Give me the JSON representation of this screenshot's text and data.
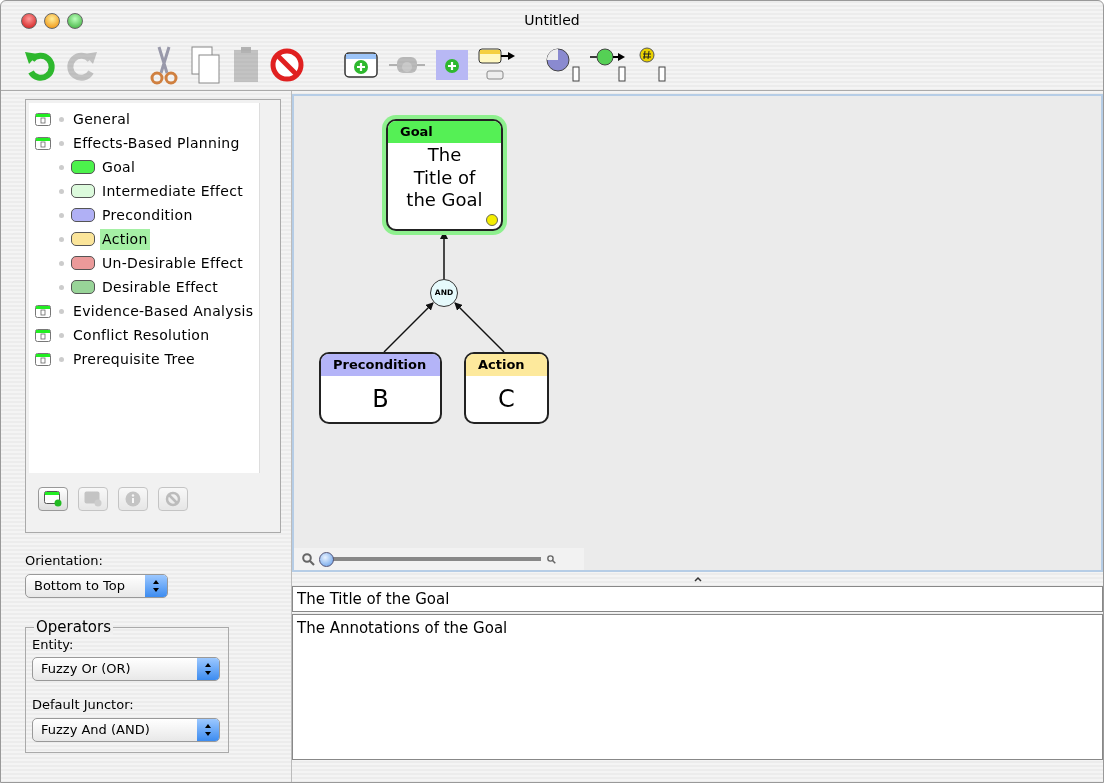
{
  "window": {
    "title": "Untitled"
  },
  "toolbar": [
    {
      "kind": "undo",
      "disabled": false
    },
    {
      "kind": "redo",
      "disabled": true
    },
    {
      "kind": "cut",
      "disabled": false
    },
    {
      "kind": "copy",
      "disabled": false
    },
    {
      "kind": "paste",
      "disabled": true
    },
    {
      "kind": "delete",
      "disabled": false
    },
    {
      "kind": "add-entity",
      "disabled": false
    },
    {
      "kind": "add-junctor",
      "disabled": true
    },
    {
      "kind": "add-child",
      "disabled": false
    },
    {
      "kind": "link",
      "disabled": false
    },
    {
      "kind": "pie",
      "disabled": false
    },
    {
      "kind": "green-link",
      "disabled": false
    },
    {
      "kind": "number",
      "disabled": false
    }
  ],
  "tree": [
    {
      "label": "General",
      "kind": "category",
      "selected": false
    },
    {
      "label": "Effects-Based Planning",
      "kind": "category",
      "selected": false,
      "children": [
        {
          "label": "Goal",
          "kind": "entity",
          "color": "#4cf24c",
          "selected": false
        },
        {
          "label": "Intermediate Effect",
          "kind": "entity",
          "color": "#dcfadc",
          "selected": false
        },
        {
          "label": "Precondition",
          "kind": "entity",
          "color": "#b0b0f5",
          "selected": false
        },
        {
          "label": "Action",
          "kind": "entity",
          "color": "#fbe59a",
          "selected": true
        },
        {
          "label": "Un-Desirable Effect",
          "kind": "entity",
          "color": "#eb9a9a",
          "selected": false
        },
        {
          "label": "Desirable Effect",
          "kind": "entity",
          "color": "#98d498",
          "selected": false
        }
      ]
    },
    {
      "label": "Evidence-Based Analysis",
      "kind": "category",
      "selected": false
    },
    {
      "label": "Conflict Resolution",
      "kind": "category",
      "selected": false
    },
    {
      "label": "Prerequisite Tree",
      "kind": "category",
      "selected": false
    }
  ],
  "tree_buttons": [
    {
      "kind": "add-category",
      "disabled": false
    },
    {
      "kind": "add-entity",
      "disabled": true
    },
    {
      "kind": "info",
      "disabled": true
    },
    {
      "kind": "delete",
      "disabled": true
    }
  ],
  "orientation": {
    "label": "Orientation:",
    "value": "Bottom to Top"
  },
  "operators": {
    "title": "Operators",
    "entity_label": "Entity:",
    "entity_value": "Fuzzy Or (OR)",
    "junctor_label": "Default Junctor:",
    "junctor_value": "Fuzzy And (AND)"
  },
  "diagram": {
    "nodes": [
      {
        "type": "Goal",
        "title": "The Title of the Goal",
        "color": "#55f055",
        "selected": true
      },
      {
        "type": "Precondition",
        "title": "B",
        "color": "#b4b4f8",
        "selected": false
      },
      {
        "type": "Action",
        "title": "C",
        "color": "#fde99c",
        "selected": false
      }
    ],
    "junctor": "AND"
  },
  "zoom": {
    "level": 0
  },
  "title_field": {
    "value": "The Title of the Goal"
  },
  "annotations": {
    "value": "The Annotations of the Goal"
  }
}
